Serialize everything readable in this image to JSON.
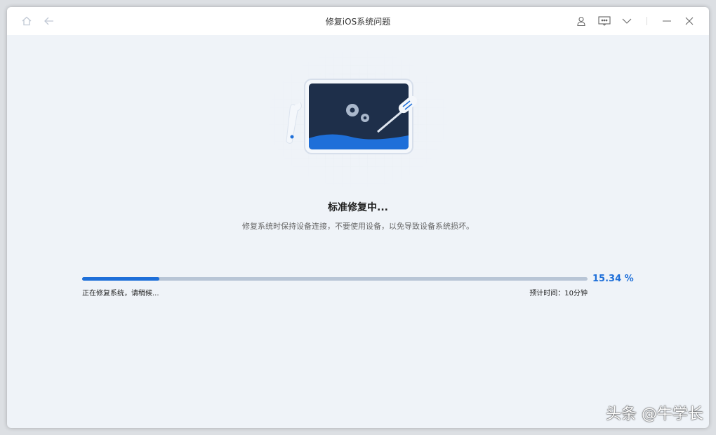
{
  "window": {
    "title": "修复iOS系统问题"
  },
  "main": {
    "heading": "标准修复中...",
    "subtitle": "修复系统时保持设备连接，不要使用设备，以免导致设备系统损坏。",
    "progress": {
      "percent": 15.34,
      "label": "15.34 %",
      "status": "正在修复系统，请稍候...",
      "eta": "预计时间：10分钟"
    }
  },
  "watermark": "头条 @牛学长",
  "colors": {
    "accent": "#1e6fd9",
    "track": "#b8c5d6",
    "screen": "#1e2f4a"
  }
}
